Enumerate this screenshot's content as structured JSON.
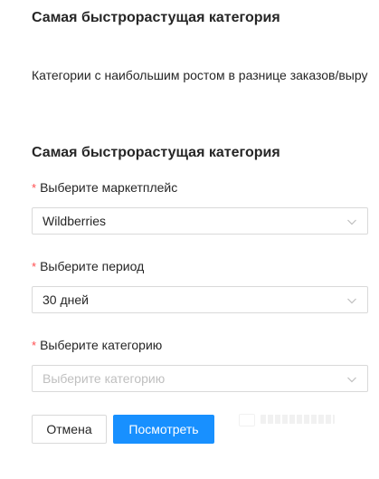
{
  "header": {
    "title": "Самая быстрорастущая категория",
    "description": "Категории с наибольшим ростом в разнице заказов/выру"
  },
  "form": {
    "title": "Самая быстрорастущая категория",
    "required_mark": "*",
    "marketplace": {
      "label": "Выберите маркетплейс",
      "value": "Wildberries"
    },
    "period": {
      "label": "Выберите период",
      "value": "30 дней"
    },
    "category": {
      "label": "Выберите категорию",
      "placeholder": "Выберите категорию"
    },
    "buttons": {
      "cancel": "Отмена",
      "view": "Посмотреть"
    }
  },
  "colors": {
    "primary": "#1890ff",
    "required": "#ff4d4f",
    "border": "#d9d9d9",
    "placeholder": "#bfbfbf"
  },
  "icons": {
    "select_arrow": "chevron-down-icon"
  }
}
